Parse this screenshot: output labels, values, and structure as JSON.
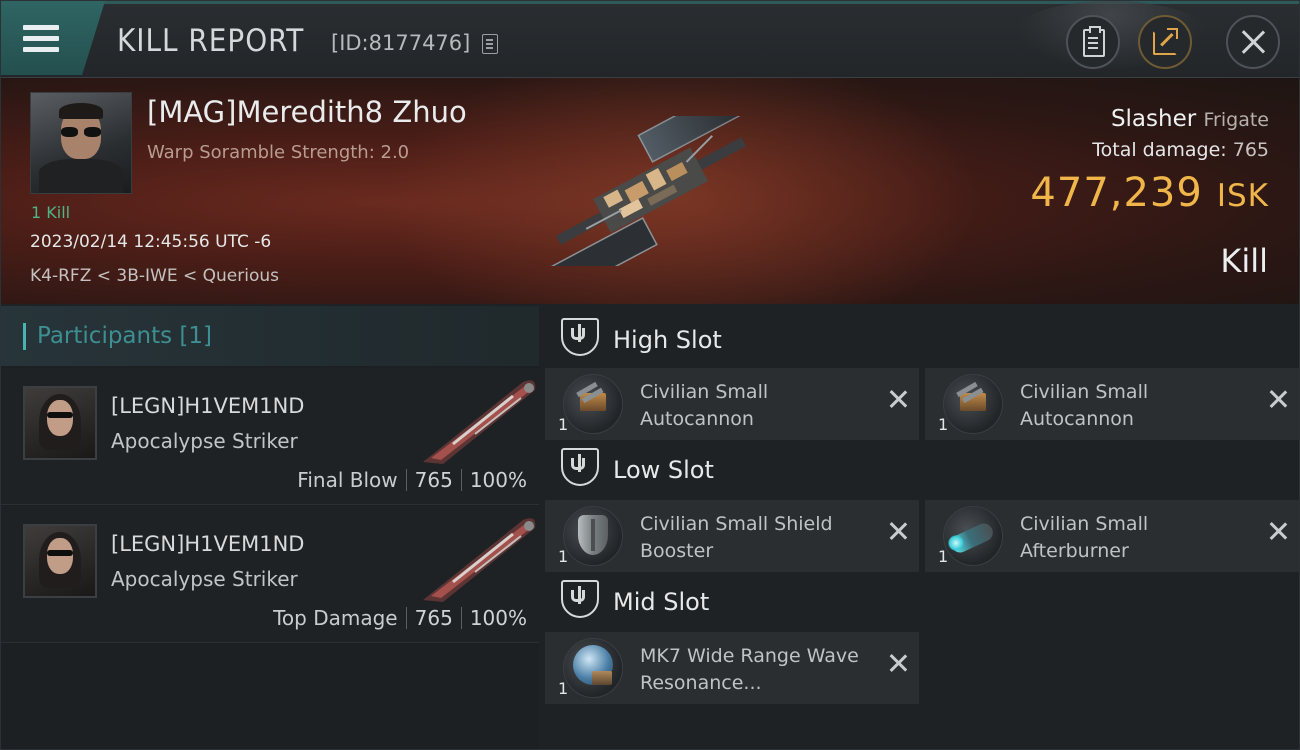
{
  "header": {
    "title": "KILL REPORT",
    "report_id": "[ID:8177476]"
  },
  "victim": {
    "name": "[MAG]Meredith8 Zhuo",
    "subtitle": "Warp Soramble Strength: 2.0",
    "kill_count": "1 Kill",
    "datetime": "2023/02/14 12:45:56 UTC -6",
    "location": "K4-RFZ < 3B-IWE < Querious",
    "ship_name": "Slasher",
    "ship_class": "Frigate",
    "total_damage_label": "Total damage:",
    "total_damage": "765",
    "isk_value": "477,239",
    "isk_unit": "ISK",
    "result": "Kill"
  },
  "participants": {
    "heading": "Participants [1]",
    "rows": [
      {
        "name": "[LEGN]H1VEM1ND",
        "ship": "Apocalypse Striker",
        "role": "Final Blow",
        "damage": "765",
        "percent": "100%"
      },
      {
        "name": "[LEGN]H1VEM1ND",
        "ship": "Apocalypse Striker",
        "role": "Top Damage",
        "damage": "765",
        "percent": "100%"
      }
    ]
  },
  "fitting": {
    "high_slot": {
      "label": "High Slot",
      "modules": [
        {
          "qty": "1",
          "name": "Civilian Small Autocannon",
          "icon": "autocannon-icon"
        },
        {
          "qty": "1",
          "name": "Civilian Small Autocannon",
          "icon": "autocannon-icon"
        }
      ]
    },
    "low_slot": {
      "label": "Low Slot",
      "modules": [
        {
          "qty": "1",
          "name": "Civilian Small Shield Booster",
          "icon": "shield-booster-icon"
        },
        {
          "qty": "1",
          "name": "Civilian Small Afterburner",
          "icon": "afterburner-icon"
        }
      ]
    },
    "mid_slot": {
      "label": "Mid Slot",
      "modules": [
        {
          "qty": "1",
          "name": "MK7 Wide Range Wave Resonance...",
          "icon": "wave-resonance-icon"
        }
      ]
    }
  },
  "colors": {
    "accent_teal": "#4ab2b1",
    "isk_gold": "#f0b64a",
    "kill_green": "#4fb486"
  }
}
